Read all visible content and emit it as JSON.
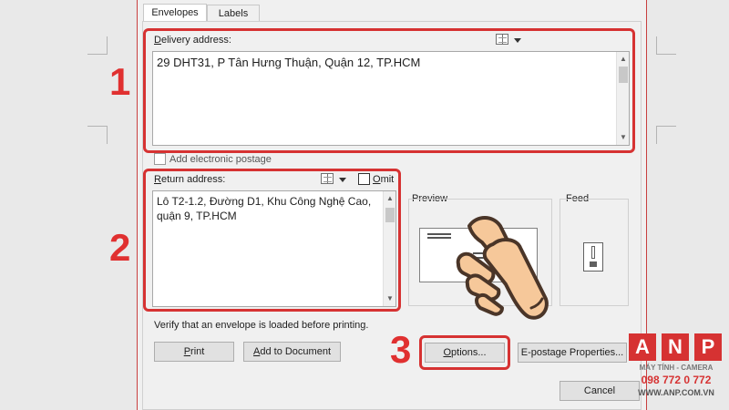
{
  "tabs": {
    "envelopes": "Envelopes",
    "labels": "Labels"
  },
  "delivery": {
    "label_prefix": "D",
    "label_rest": "elivery address:",
    "text": "29 DHT31, P Tân Hưng Thuận, Quận 12, TP.HCM"
  },
  "postage": {
    "label": "Add electronic postage"
  },
  "return": {
    "label_prefix": "R",
    "label_rest": "eturn address:",
    "omit_prefix": "O",
    "omit_rest": "mit",
    "text": "Lô T2-1.2, Đường D1, Khu Công Nghệ Cao,\nquận 9, TP.HCM"
  },
  "preview": {
    "label": "Preview"
  },
  "feed": {
    "label": "Feed"
  },
  "verify_text": "Verify that an envelope is loaded before printing.",
  "buttons": {
    "print_prefix": "P",
    "print_rest": "rint",
    "add_prefix": "A",
    "add_rest": "dd to Document",
    "options_prefix": "O",
    "options_rest": "ptions...",
    "epostage": "E-postage Properties...",
    "cancel": "Cancel"
  },
  "annotations": {
    "one": "1",
    "two": "2",
    "three": "3"
  },
  "logo": {
    "letters": [
      "A",
      "N",
      "P"
    ],
    "tagline": "MÁY TÍNH - CAMERA",
    "phone": "098 772 0 772",
    "website": "WWW.ANP.COM.VN"
  },
  "colors": {
    "highlight": "#d63232",
    "dialog_bg": "#f0f0f0",
    "brand": "#d63232"
  }
}
